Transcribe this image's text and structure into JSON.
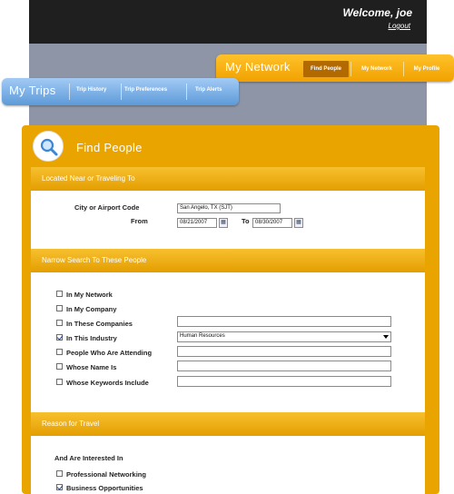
{
  "header": {
    "welcome": "Welcome, joe",
    "logout": "Logout"
  },
  "network_nav": {
    "title": "My Network",
    "tabs": [
      "Find People",
      "My Network",
      "My Profile"
    ],
    "active_tab": "Find People"
  },
  "trips_nav": {
    "title": "My Trips",
    "tabs": [
      "Trip History",
      "Trip Preferences",
      "Trip Alerts"
    ]
  },
  "panel": {
    "title": "Find People",
    "icon": "magnifier-icon"
  },
  "location_section": {
    "heading": "Located Near or Traveling To",
    "city_label": "City or Airport Code",
    "city_value": "San Angelo, TX (SJT)",
    "from_label": "From",
    "from_value": "08/21/2007",
    "to_label": "To",
    "to_value": "08/30/2007"
  },
  "narrow_section": {
    "heading": "Narrow Search To These People",
    "rows": [
      {
        "label": "In My Network",
        "checked": false,
        "field": null
      },
      {
        "label": "In My Company",
        "checked": false,
        "field": null
      },
      {
        "label": "In These Companies",
        "checked": false,
        "field": "text",
        "value": ""
      },
      {
        "label": "In This Industry",
        "checked": true,
        "field": "select",
        "value": "Human Resources"
      },
      {
        "label": "People Who Are Attending",
        "checked": false,
        "field": "text",
        "value": ""
      },
      {
        "label": "Whose Name Is",
        "checked": false,
        "field": "text",
        "value": ""
      },
      {
        "label": "Whose Keywords Include",
        "checked": false,
        "field": "text",
        "value": ""
      }
    ]
  },
  "travel_section": {
    "heading": "Reason for Travel",
    "interest_label": "And Are Interested In",
    "options": [
      {
        "label": "Professional Networking",
        "checked": false
      },
      {
        "label": "Business Opportunities",
        "checked": true
      }
    ]
  },
  "colors": {
    "accent": "#e9a400",
    "trips_blue": "#5d9ad8",
    "topbar": "#1f1f1f",
    "band": "#8e95a7"
  }
}
